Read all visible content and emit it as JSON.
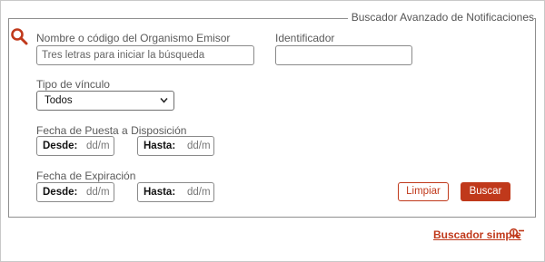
{
  "panel": {
    "title": "Buscador Avanzado de Notificaciones"
  },
  "fields": {
    "organismo": {
      "label": "Nombre o código del Organismo Emisor",
      "placeholder": "Tres letras para iniciar la búsqueda",
      "value": ""
    },
    "identificador": {
      "label": "Identificador",
      "value": ""
    },
    "tipo_vinculo": {
      "label": "Tipo de vínculo",
      "selected": "Todos"
    },
    "fecha_puesta": {
      "label": "Fecha de Puesta a Disposición",
      "desde_label": "Desde:",
      "desde_value": "dd/m",
      "hasta_label": "Hasta:",
      "hasta_value": "dd/m"
    },
    "fecha_expiracion": {
      "label": "Fecha de Expiración",
      "desde_label": "Desde:",
      "desde_value": "dd/m",
      "hasta_label": "Hasta:",
      "hasta_value": "dd/m"
    }
  },
  "buttons": {
    "clear": "Limpiar",
    "search": "Buscar"
  },
  "simple_search": {
    "label": "Buscador simple"
  },
  "icons": {
    "panel": "search-icon",
    "select": "chevron-down-icon",
    "simple": "search-minus-icon"
  },
  "colors": {
    "accent": "#c0391b",
    "border": "#8f8f8f",
    "text": "#5a5a5a"
  }
}
